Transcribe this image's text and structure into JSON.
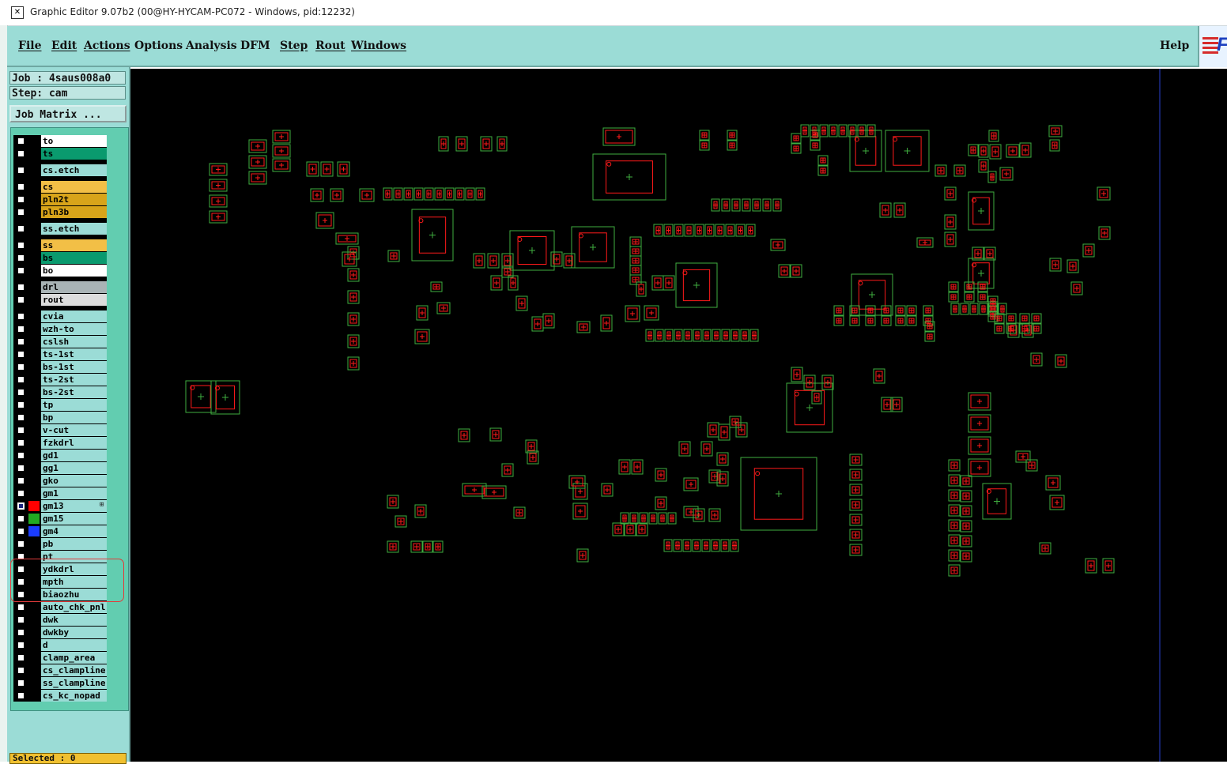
{
  "window": {
    "title": "Graphic Editor 9.07b2 (00@HY-HYCAM-PC072 - Windows, pid:12232)",
    "icon": "x-window-icon"
  },
  "menu": {
    "items": [
      "File",
      "Edit",
      "Actions",
      "Options",
      "Analysis",
      "DFM",
      "Step",
      "Rout",
      "Windows"
    ],
    "help": "Help"
  },
  "logo": {
    "letter": "F",
    "icon": "company-logo"
  },
  "job": {
    "job_line": "Job : 4saus008a0",
    "step_line": "Step: cam",
    "matrix_button": "Job Matrix ..."
  },
  "layers": [
    {
      "name": "to",
      "color": "#ffffff",
      "checked": false
    },
    {
      "name": "ts",
      "color": "#0a9a6e",
      "checked": false
    },
    {
      "name": "cs.etch",
      "color": "#9bdcd6",
      "checked": false
    },
    {
      "name": "cs",
      "color": "#f2bf46",
      "checked": false
    },
    {
      "name": "pln2t",
      "color": "#d8a41a",
      "checked": false
    },
    {
      "name": "pln3b",
      "color": "#d8a41a",
      "checked": false
    },
    {
      "name": "ss.etch",
      "color": "#9bdcd6",
      "checked": false
    },
    {
      "name": "ss",
      "color": "#f2bf46",
      "checked": false
    },
    {
      "name": "bs",
      "color": "#0a9a6e",
      "checked": false
    },
    {
      "name": "bo",
      "color": "#ffffff",
      "checked": false
    },
    {
      "name": "drl",
      "color": "#a9b3b5",
      "checked": false
    },
    {
      "name": "rout",
      "color": "#dcdcdc",
      "checked": false
    },
    {
      "name": "cvia",
      "color": "#9bdcd6",
      "checked": false
    },
    {
      "name": "wzh-to",
      "color": "#9bdcd6",
      "checked": false
    },
    {
      "name": "cslsh",
      "color": "#9bdcd6",
      "checked": false
    },
    {
      "name": "ts-1st",
      "color": "#9bdcd6",
      "checked": false
    },
    {
      "name": "bs-1st",
      "color": "#9bdcd6",
      "checked": false
    },
    {
      "name": "ts-2st",
      "color": "#9bdcd6",
      "checked": false
    },
    {
      "name": "bs-2st",
      "color": "#9bdcd6",
      "checked": false
    },
    {
      "name": "tp",
      "color": "#9bdcd6",
      "checked": false
    },
    {
      "name": "bp",
      "color": "#9bdcd6",
      "checked": false
    },
    {
      "name": "v-cut",
      "color": "#9bdcd6",
      "checked": false
    },
    {
      "name": "fzkdrl",
      "color": "#9bdcd6",
      "checked": false
    },
    {
      "name": "gd1",
      "color": "#9bdcd6",
      "checked": false
    },
    {
      "name": "gg1",
      "color": "#9bdcd6",
      "checked": false
    },
    {
      "name": "gko",
      "color": "#9bdcd6",
      "checked": false
    },
    {
      "name": "gm1",
      "color": "#9bdcd6",
      "checked": false
    },
    {
      "name": "gm13",
      "color": "#9bdcd6",
      "checked": true,
      "display_color": "#ff0000"
    },
    {
      "name": "gm15",
      "color": "#9bdcd6",
      "checked": false,
      "display_color": "#22aa22"
    },
    {
      "name": "gm4",
      "color": "#9bdcd6",
      "checked": false,
      "display_color": "#1a3cff"
    },
    {
      "name": "pb",
      "color": "#9bdcd6",
      "checked": false
    },
    {
      "name": "pt",
      "color": "#9bdcd6",
      "checked": false
    },
    {
      "name": "ydkdrl",
      "color": "#9bdcd6",
      "checked": false
    },
    {
      "name": "mpth",
      "color": "#9bdcd6",
      "checked": false
    },
    {
      "name": "biaozhu",
      "color": "#9bdcd6",
      "checked": false
    },
    {
      "name": "auto_chk_pnl",
      "color": "#9bdcd6",
      "checked": false
    },
    {
      "name": "dwk",
      "color": "#9bdcd6",
      "checked": false
    },
    {
      "name": "dwkby",
      "color": "#9bdcd6",
      "checked": false
    },
    {
      "name": "d",
      "color": "#9bdcd6",
      "checked": false
    },
    {
      "name": "clamp_area",
      "color": "#9bdcd6",
      "checked": false
    },
    {
      "name": "cs_clampline",
      "color": "#9bdcd6",
      "checked": false
    },
    {
      "name": "ss_clampline",
      "color": "#9bdcd6",
      "checked": false
    },
    {
      "name": "cs_kc_nopad",
      "color": "#9bdcd6",
      "checked": false
    }
  ],
  "status": {
    "selected": "Selected : 0"
  },
  "colors": {
    "menubar": "#9bdcd6",
    "panel": "#62cdb0",
    "canvas": "#000000",
    "pad_outline": "#3fae3f",
    "pad_fill": "#ff1a1a",
    "highlight": "#e23b3b",
    "vertical_line": "#2a3fd0"
  }
}
